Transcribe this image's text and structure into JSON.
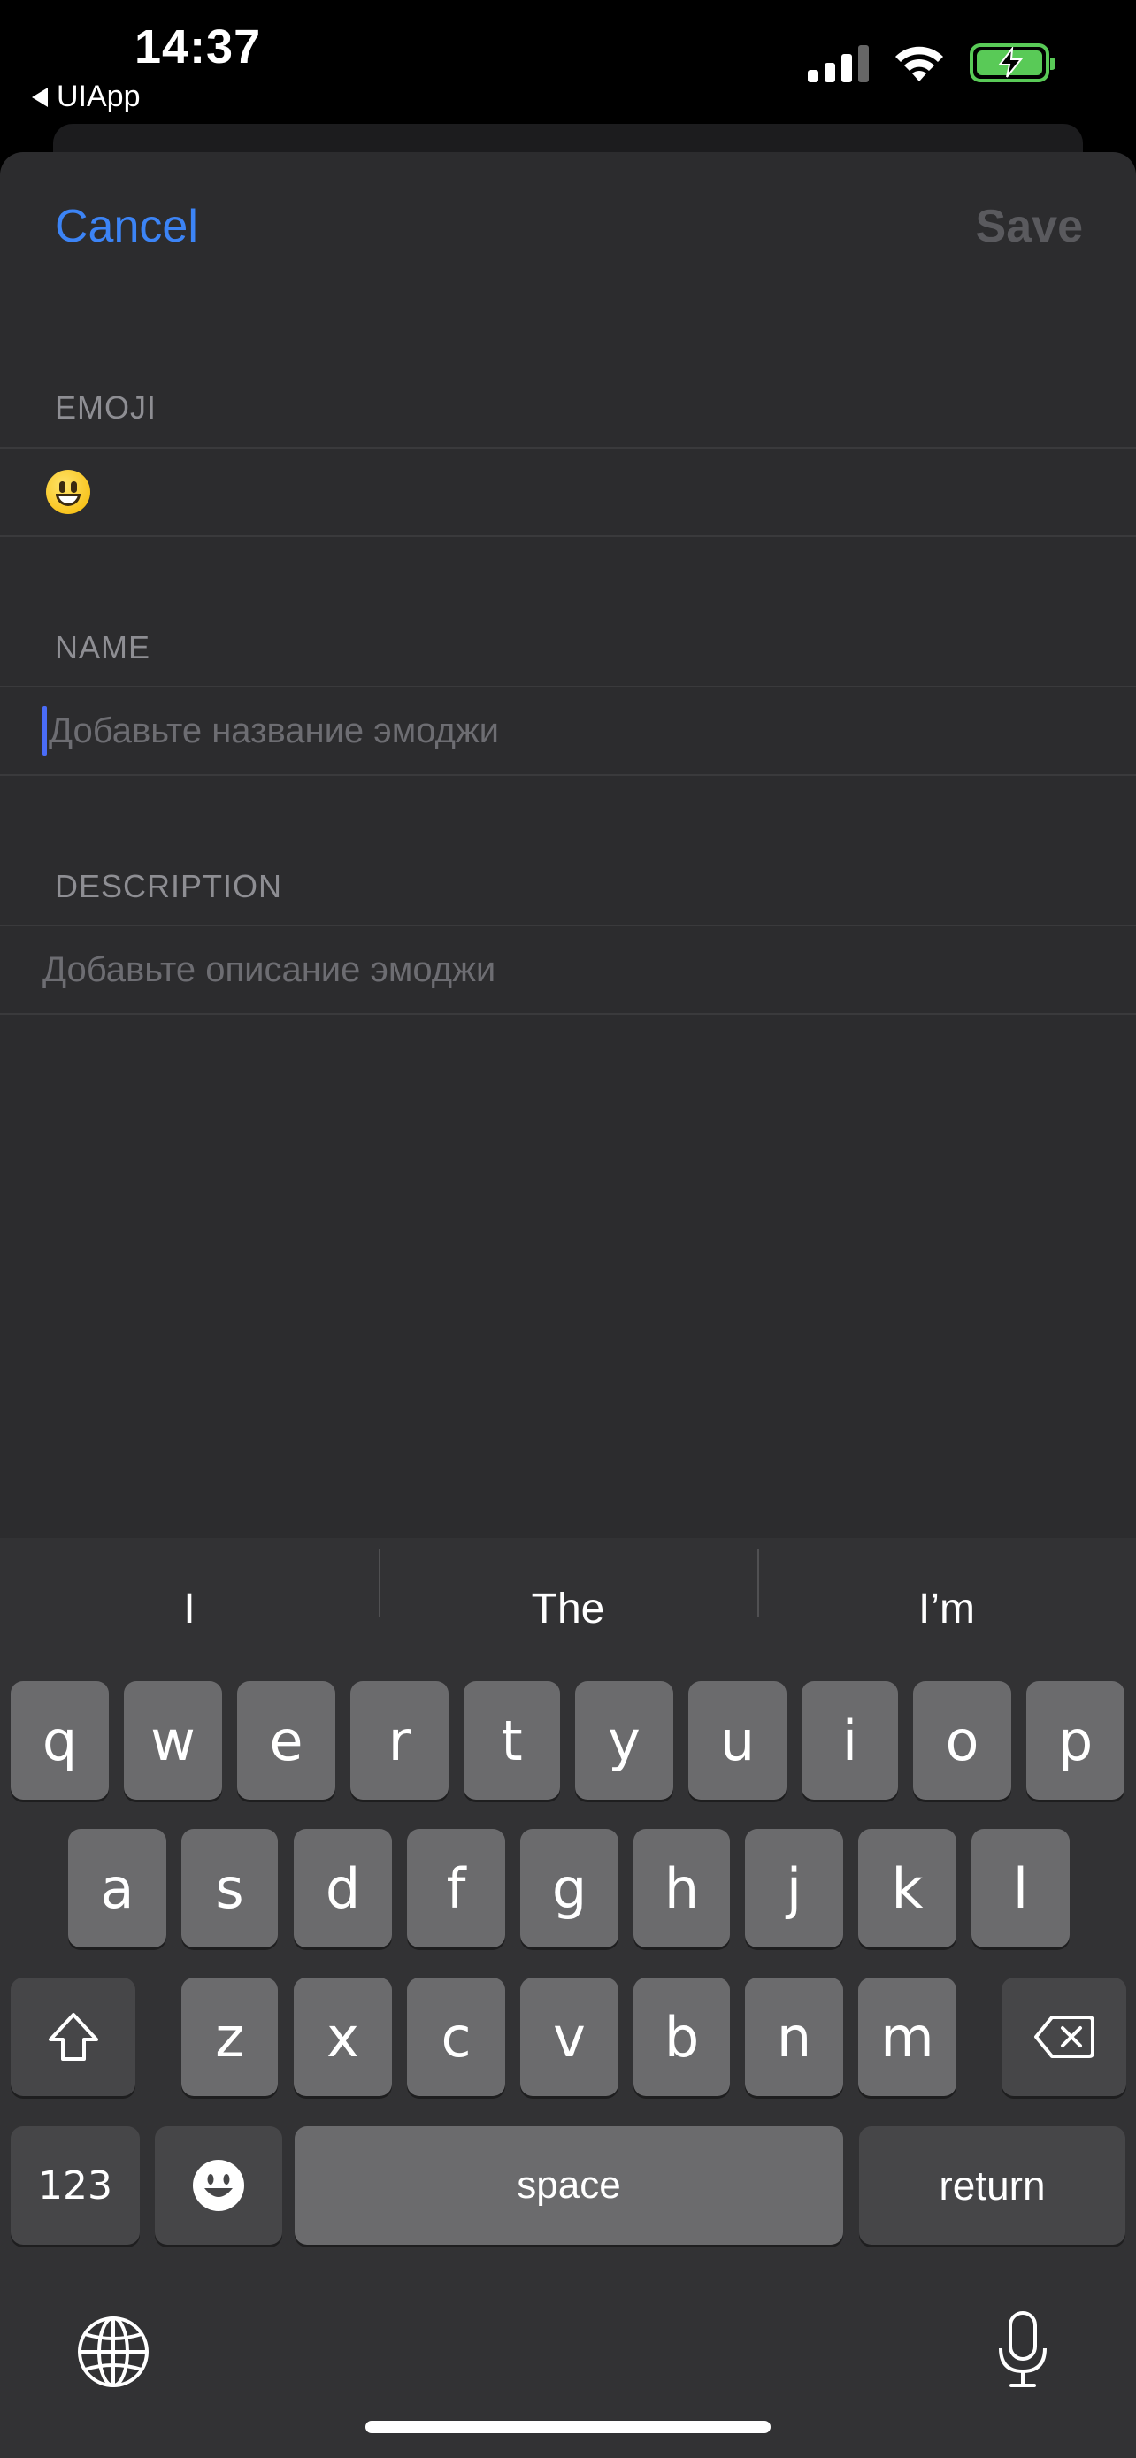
{
  "status_bar": {
    "time": "14:37",
    "back_app": "UIApp",
    "icons": [
      "cellular-signal-icon",
      "wifi-icon",
      "battery-charging-icon"
    ],
    "battery_color": "#59ca57"
  },
  "nav": {
    "cancel_label": "Cancel",
    "save_label": "Save",
    "accent_color": "#3c84f6"
  },
  "form": {
    "emoji": {
      "header": "EMOJI",
      "value": "😃"
    },
    "name": {
      "header": "NAME",
      "placeholder": "Добавьте название эмоджи"
    },
    "description": {
      "header": "DESCRIPTION",
      "placeholder": "Добавьте описание эмоджи"
    }
  },
  "keyboard": {
    "suggestions": [
      "I",
      "The",
      "I’m"
    ],
    "row1": [
      "q",
      "w",
      "e",
      "r",
      "t",
      "y",
      "u",
      "i",
      "o",
      "p"
    ],
    "row2": [
      "a",
      "s",
      "d",
      "f",
      "g",
      "h",
      "j",
      "k",
      "l"
    ],
    "row3": [
      "z",
      "x",
      "c",
      "v",
      "b",
      "n",
      "m"
    ],
    "numbers_label": "123",
    "space_label": "space",
    "return_label": "return",
    "icons": [
      "shift-icon",
      "backspace-icon",
      "emoji-icon",
      "globe-icon",
      "microphone-icon"
    ]
  }
}
